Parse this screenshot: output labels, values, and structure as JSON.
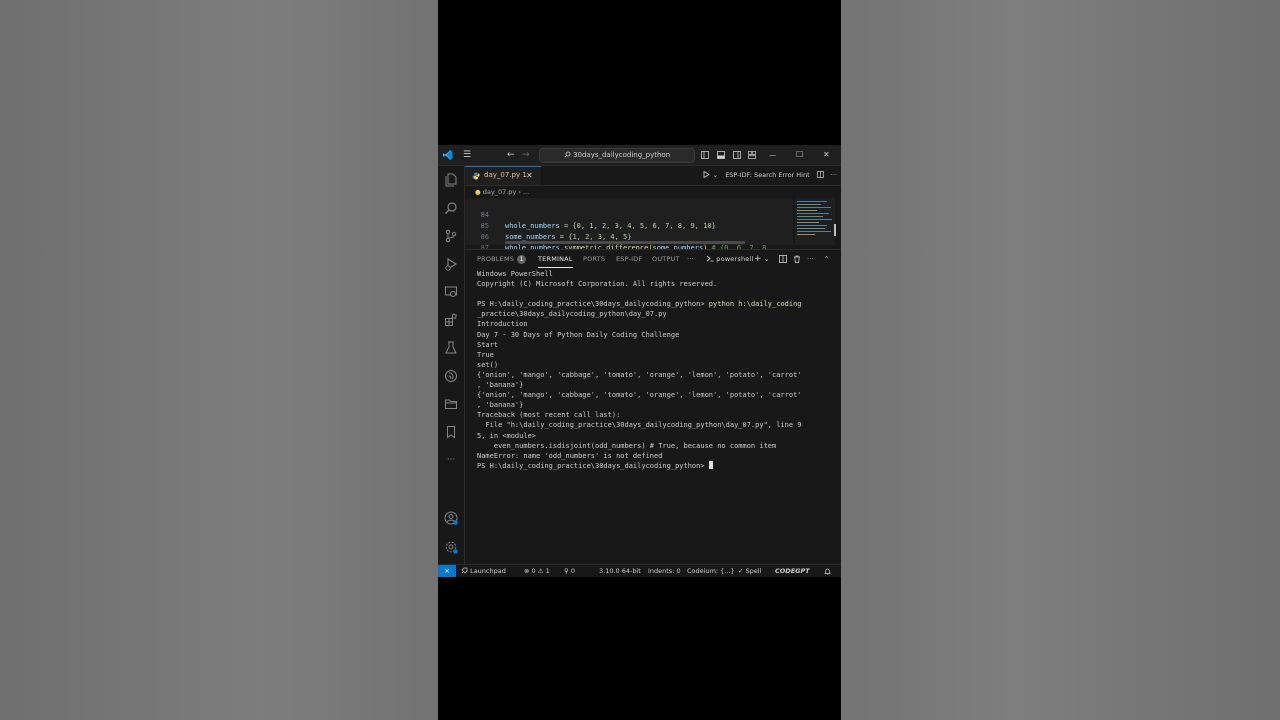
{
  "window": {
    "search_text": "30days_dailycoding_python",
    "back_glyph": "←",
    "forward_glyph": "→",
    "min_glyph": "—",
    "max_glyph": "☐",
    "close_glyph": "✕",
    "menu_glyph": "☰"
  },
  "tabs": {
    "active_label": "day_07.py 1",
    "close_glyph": "✕",
    "run_hint": "ESP-IDF: Search Error Hint",
    "more_glyph": "···"
  },
  "breadcrumb": {
    "file": "day_07.py",
    "sep": "› ..."
  },
  "editor": {
    "lines": [
      {
        "number": "84"
      },
      {
        "number": "85"
      },
      {
        "number": "86"
      },
      {
        "number": "87"
      }
    ],
    "line84": {
      "var": "whole_numbers",
      "op": " = ",
      "val": "{0, 1, 2, 3, 4, 5, 6, 7, 8, 9, 10}"
    },
    "line85": {
      "var": "some_numbers",
      "op": " = ",
      "val": "{1, 2, 3, 4, 5}"
    },
    "line86": {
      "var": "whole_numbers",
      "dot": ".",
      "fn": "symmetric_difference",
      "open": "(",
      "arg": "some_numbers",
      "close": ")",
      "comment": " # {0, 6, 7, 8,"
    }
  },
  "panel": {
    "tabs": [
      {
        "label": "PROBLEMS",
        "badge": "1"
      },
      {
        "label": "TERMINAL"
      },
      {
        "label": "PORTS"
      },
      {
        "label": "ESP-IDF"
      },
      {
        "label": "OUTPUT"
      }
    ],
    "more_glyph": "···",
    "shell_name": "powershell",
    "plus_glyph": "+",
    "chevron_glyph": "⌄",
    "split_glyph": "▯",
    "trash_glyph": "🗑",
    "panel_more": "···",
    "collapse_glyph": "⌃"
  },
  "terminal": {
    "lines": [
      "Windows PowerShell",
      "Copyright (C) Microsoft Corporation. All rights reserved.",
      "",
      "",
      "_practice\\30days_dailycoding_python\\day_07.py",
      "Introduction",
      "Day 7 - 30 Days of Python Daily Coding Challenge",
      "Start",
      "True",
      "set()",
      "{'onion', 'mango', 'cabbage', 'tomato', 'orange', 'lemon', 'potato', 'carrot'",
      ", 'banana'}",
      "{'onion', 'mango', 'cabbage', 'tomato', 'orange', 'lemon', 'potato', 'carrot'",
      ", 'banana'}",
      "Traceback (most recent call last):",
      "  File \"h:\\daily_coding_practice\\30days_dailycoding_python\\day_07.py\", line 9",
      "5, in <module>",
      "    even_numbers.isdisjoint(odd_numbers) # True, because no common item",
      "NameError: name 'odd_numbers' is not defined"
    ],
    "prompt1": "PS H:\\daily_coding_practice\\30days_dailycoding_python> ",
    "command": "python h:\\daily_coding",
    "prompt2": "PS H:\\daily_coding_practice\\30days_dailycoding_python> "
  },
  "statusbar": {
    "remote_glyph": "⨯",
    "launchpad": "Launchpad",
    "problems": "⊗ 0 ⚠ 1",
    "ports": "⚲ 0",
    "python_version": "3.10.0 64-bit",
    "indents": "Indents: 0",
    "codeium": "Codeium: {...}",
    "spell": "✓ Spell",
    "codegpt": "CODEGPT",
    "bell_glyph": "🔔"
  },
  "colors": {
    "accent": "#0078d4",
    "editor_bg": "#1f1f1f",
    "panel_bg": "#181818"
  }
}
